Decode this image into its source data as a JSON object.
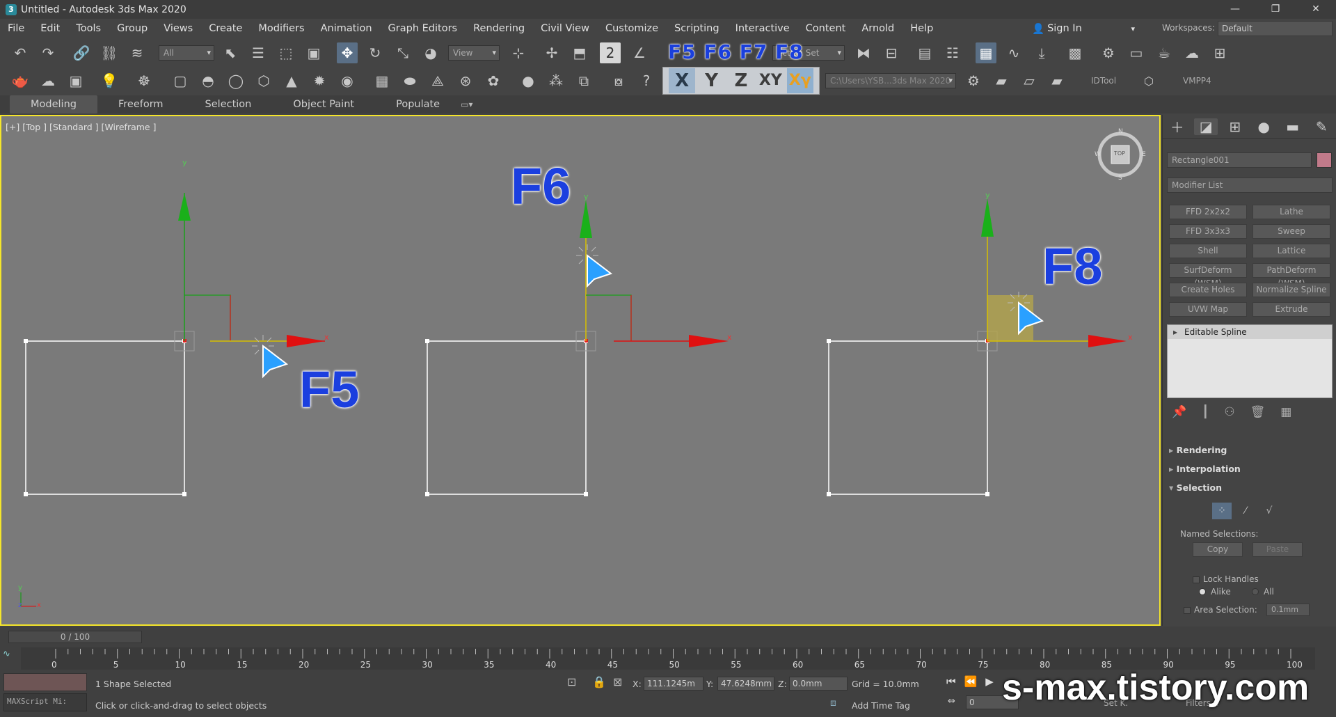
{
  "window": {
    "title": "Untitled - Autodesk 3ds Max 2020",
    "minimize": "—",
    "restore": "❐",
    "close": "✕"
  },
  "menu": [
    "File",
    "Edit",
    "Tools",
    "Group",
    "Views",
    "Create",
    "Modifiers",
    "Animation",
    "Graph Editors",
    "Rendering",
    "Civil View",
    "Customize",
    "Scripting",
    "Interactive",
    "Content",
    "Arnold",
    "Help"
  ],
  "signin": {
    "label": "Sign In"
  },
  "workspaces": {
    "label": "Workspaces:",
    "value": "Default"
  },
  "toolbar": {
    "selection_filter": "All",
    "ref_coord": "View",
    "named_selection": "ection Set",
    "project_path": "C:\\Users\\YSB...3ds Max 2020",
    "idtool": "IDTool",
    "vmpp4": "VMPP4"
  },
  "axis_constraints": {
    "x": "X",
    "y": "Y",
    "z": "Z",
    "xy": "XY",
    "xy2": "Xγ"
  },
  "fkeys_label": "F5 F6 F7 F8",
  "ribbon_tabs": [
    "Modeling",
    "Freeform",
    "Selection",
    "Object Paint",
    "Populate"
  ],
  "viewport": {
    "label": "[+] [Top ] [Standard ] [Wireframe ]",
    "annotations": {
      "f5": "F5",
      "f6": "F6",
      "f8": "F8"
    },
    "axis_letters": {
      "x": "x",
      "y": "y"
    },
    "viewcube": {
      "top": "TOP",
      "n": "N",
      "s": "S",
      "w": "W",
      "e": "E"
    },
    "corner_axes": {
      "x": "x",
      "y": "y",
      "z": "z"
    }
  },
  "command_panel": {
    "object_name": "Rectangle001",
    "modifier_list": "Modifier List",
    "buttons": [
      "FFD 2x2x2",
      "Lathe",
      "FFD 3x3x3",
      "Sweep",
      "Shell",
      "Lattice",
      "SurfDeform (WSM)",
      "PathDeform (WSM)",
      "Create Holes",
      "Normalize Spline",
      "UVW Map",
      "Extrude"
    ],
    "stack_item": "Editable Spline",
    "rollouts": {
      "rendering": "Rendering",
      "interpolation": "Interpolation",
      "selection": "Selection"
    },
    "named_selections": "Named Selections:",
    "copy": "Copy",
    "paste": "Paste",
    "lock_handles": "Lock Handles",
    "alike": "Alike",
    "all": "All",
    "area_selection": "Area Selection:",
    "area_value": "0.1mm"
  },
  "timeline": {
    "frame": "0 / 100",
    "ticks": [
      "0",
      "5",
      "10",
      "15",
      "20",
      "25",
      "30",
      "35",
      "40",
      "45",
      "50",
      "55",
      "60",
      "65",
      "70",
      "75",
      "80",
      "85",
      "90",
      "95",
      "100"
    ]
  },
  "status": {
    "selected": "1 Shape Selected",
    "prompt": "Click or click-and-drag to select objects",
    "maxscript": "MAXScript Mi:",
    "x_label": "X:",
    "x": "111.1245m",
    "y_label": "Y:",
    "y": "47.6248mm",
    "z_label": "Z:",
    "z": "0.0mm",
    "grid": "Grid = 10.0mm",
    "add_time_tag": "Add Time Tag",
    "frame_value": "0",
    "set_k": "Set K.",
    "filters": "Filters..."
  },
  "watermark": "s-max.tistory.com"
}
